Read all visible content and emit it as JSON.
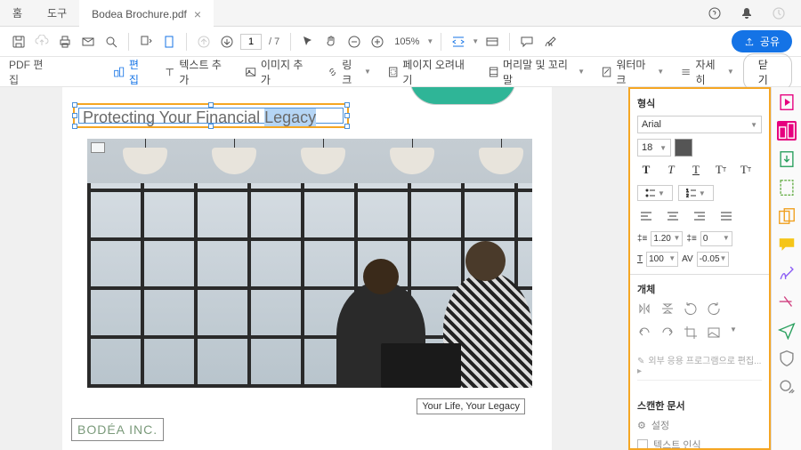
{
  "titlebar": {
    "tabs": [
      {
        "label": "홈"
      },
      {
        "label": "도구"
      },
      {
        "label": "Bodea Brochure.pdf",
        "active": true
      }
    ]
  },
  "toolbar": {
    "page_current": "1",
    "page_total": "/ 7",
    "zoom": "105%"
  },
  "share": {
    "label": "공유"
  },
  "editbar": {
    "mode": "PDF 편집",
    "edit": "편집",
    "add_text": "텍스트 추가",
    "add_image": "이미지 추가",
    "link": "링크",
    "crop": "페이지 오려내기",
    "header_footer": "머리말 및 꼬리말",
    "watermark": "워터마크",
    "more": "자세히",
    "close": "닫기"
  },
  "document": {
    "headline_pre": "Protecting Your Financial ",
    "headline_sel": "Legacy",
    "caption": "Your Life, Your Legacy",
    "logo": "BODÉA INC."
  },
  "format": {
    "title": "형식",
    "font": "Arial",
    "size": "18",
    "line_height": "1.20",
    "para_spacing": "0",
    "text_scale": "100",
    "char_spacing": "-0.05"
  },
  "object": {
    "title": "개체",
    "external": "외부 응용 프로그램으로 편집..."
  },
  "scan": {
    "title": "스캔한 문서",
    "settings": "설정",
    "ocr": "텍스트 인식"
  }
}
